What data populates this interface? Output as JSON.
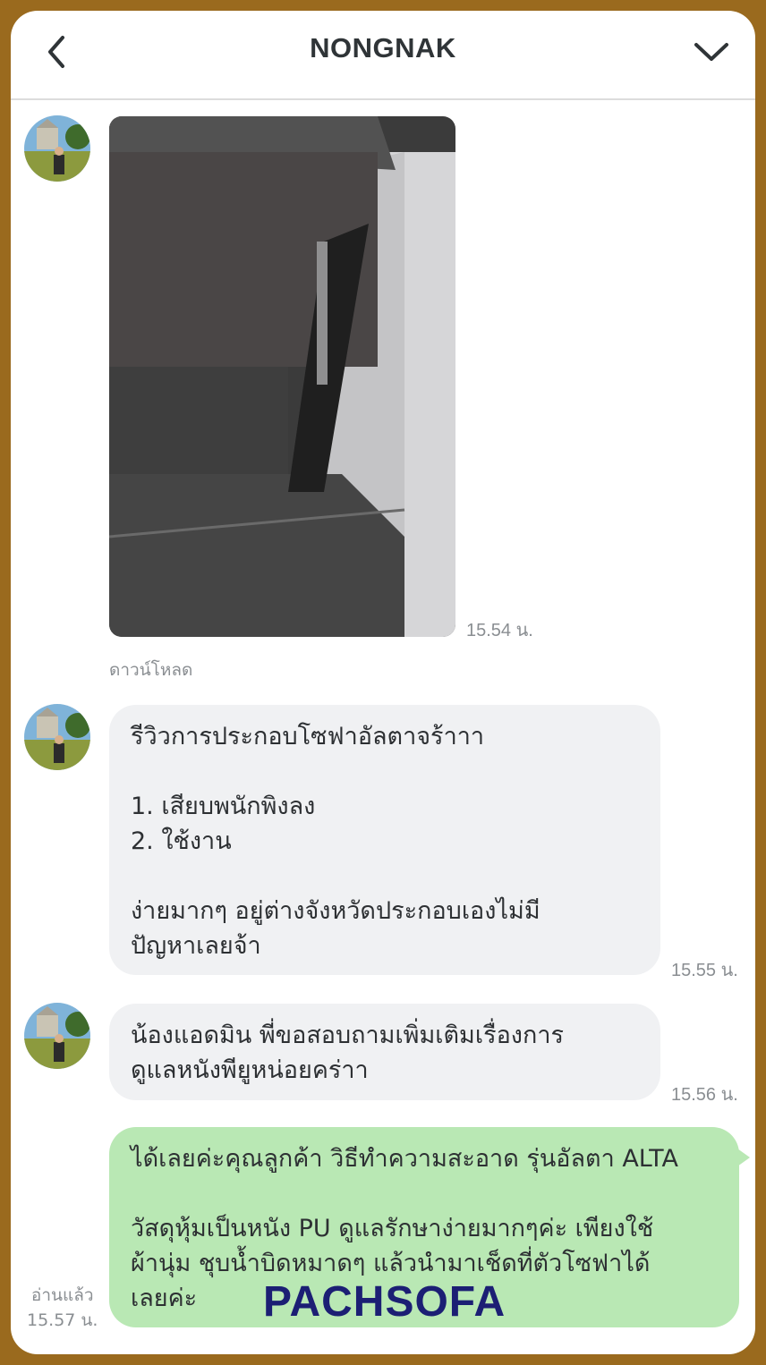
{
  "header": {
    "title": "NONGNAK"
  },
  "messages": {
    "photo_time": "15.54 น.",
    "download_label": "ดาวน์โหลด",
    "msg1": {
      "text": "รีวิวการประกอบโซฟาอัลตาจร้าาา\n\n1. เสียบพนักพิงลง\n2. ใช้งาน\n\nง่ายมากๆ อยู่ต่างจังหวัดประกอบเองไม่มี\nปัญหาเลยจ้า",
      "time": "15.55 น."
    },
    "msg2": {
      "text": "น้องแอดมิน พี่ขอสอบถามเพิ่มเติมเรื่องการ\nดูแลหนังพียูหน่อยคร่าา",
      "time": "15.56 น."
    },
    "reply": {
      "text": "ได้เลยค่ะคุณลูกค้า วิธีทำความสะอาด รุ่นอัลตา ALTA\n\nวัสดุหุ้มเป็นหนัง PU ดูแลรักษาง่ายมากๆค่ะ เพียงใช้\nผ้านุ่ม ชุบน้ำบิดหมาดๆ แล้วนำมาเช็ดที่ตัวโซฟาได้\nเลยค่ะ",
      "read_label": "อ่านแล้ว",
      "time": "15.57 น."
    }
  },
  "watermark": {
    "brand": "PACHSOFA"
  },
  "colors": {
    "frame": "#9a6a1e",
    "bubble_in": "#f0f1f3",
    "bubble_out": "#b9e8b4",
    "brand": "#1c1f74"
  }
}
